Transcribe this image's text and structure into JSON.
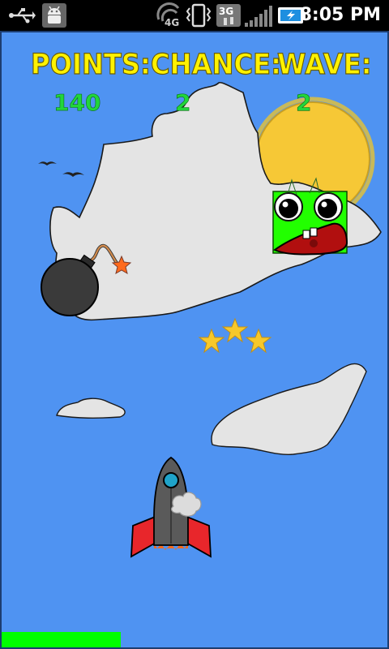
{
  "status_bar": {
    "time": "8:05 PM",
    "network": "4G",
    "data_type": "3G",
    "icons": [
      "usb-icon",
      "android-debug-icon",
      "4g-signal-icon",
      "phone-vibrate-icon",
      "3g-data-icon",
      "signal-bars-icon",
      "battery-charging-icon"
    ]
  },
  "hud": {
    "points_label": "POINTS:",
    "points_value": "140",
    "chance_label": "CHANCE:",
    "chance_value": "2",
    "wave_label": "WAVE:",
    "wave_value": "2"
  },
  "colors": {
    "sky": "#4f93f2",
    "hud_label": "#fff200",
    "hud_value": "#22d63a",
    "energy_bar": "#00ff00",
    "enemy": "#22ff00"
  },
  "energy_level": 0.31
}
